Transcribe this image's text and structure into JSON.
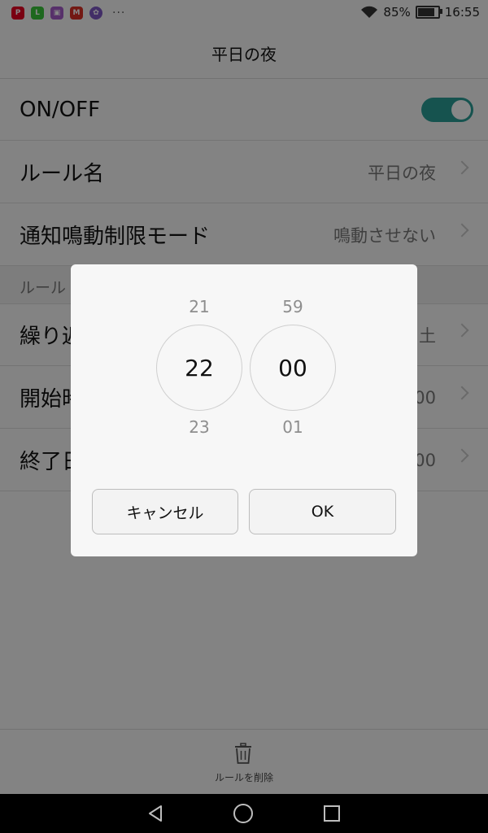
{
  "status_bar": {
    "apps": [
      {
        "name": "pinterest-icon",
        "color": "#e60023",
        "glyph": "P"
      },
      {
        "name": "line-icon",
        "color": "#3ac43a",
        "glyph": "L"
      },
      {
        "name": "gallery-icon",
        "color": "#a45cc8",
        "glyph": "▣"
      },
      {
        "name": "gmail-icon",
        "color": "#d93025",
        "glyph": "M"
      },
      {
        "name": "app-icon",
        "color": "#7e57c2",
        "glyph": "✿"
      }
    ],
    "more": "···",
    "battery": "85%",
    "battery_level": 0.85,
    "time": "16:55"
  },
  "header": {
    "title": "平日の夜"
  },
  "settings": {
    "onoff": {
      "label": "ON/OFF",
      "enabled": true
    },
    "rule_name": {
      "label": "ルール名",
      "value": "平日の夜"
    },
    "mode": {
      "label": "通知鳴動制限モード",
      "value": "鳴動させない"
    },
    "section": "ルール",
    "repeat": {
      "label": "繰り返",
      "value": "土"
    },
    "start": {
      "label": "開始時",
      "value": "00"
    },
    "end": {
      "label": "終了日",
      "value": "00"
    }
  },
  "bottom": {
    "delete_label": "ルールを削除"
  },
  "dialog": {
    "hours": {
      "prev": "21",
      "current": "22",
      "next": "23"
    },
    "minutes": {
      "prev": "59",
      "current": "00",
      "next": "01"
    },
    "cancel_label": "キャンセル",
    "ok_label": "OK"
  },
  "colors": {
    "accent": "#2a9d96"
  }
}
